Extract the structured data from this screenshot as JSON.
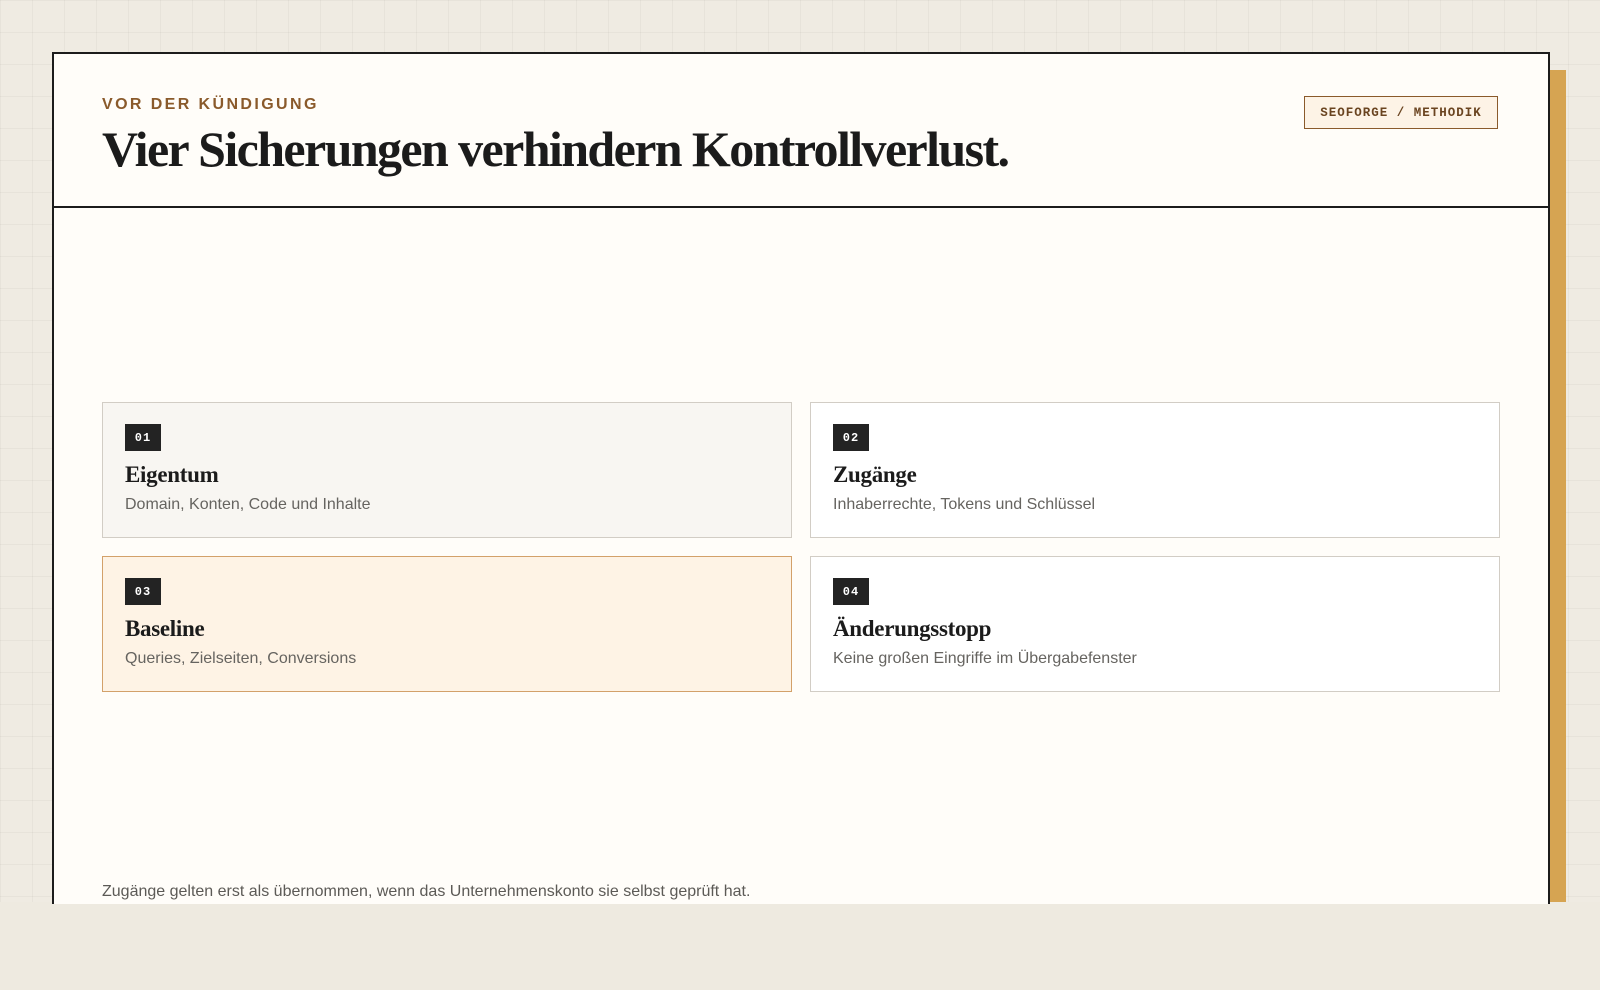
{
  "header": {
    "eyebrow": "VOR DER KÜNDIGUNG",
    "title": "Vier Sicherungen verhindern Kontrollverlust.",
    "tag": "SEOFORGE / METHODIK"
  },
  "cards": [
    {
      "number": "01",
      "title": "Eigentum",
      "description": "Domain, Konten, Code und Inhalte"
    },
    {
      "number": "02",
      "title": "Zugänge",
      "description": "Inhaberrechte, Tokens und Schlüssel"
    },
    {
      "number": "03",
      "title": "Baseline",
      "description": "Queries, Zielseiten, Conversions",
      "highlighted": true
    },
    {
      "number": "04",
      "title": "Änderungsstopp",
      "description": "Keine großen Eingriffe im Übergabefenster"
    }
  ],
  "footnote": "Zugänge gelten erst als übernommen, wenn das Unternehmenskonto sie selbst geprüft hat.",
  "colors": {
    "accent": "#8a5a2b",
    "shadow": "#d6a452",
    "highlight_card": "#fef3e5",
    "ink": "#1b1b1b"
  }
}
